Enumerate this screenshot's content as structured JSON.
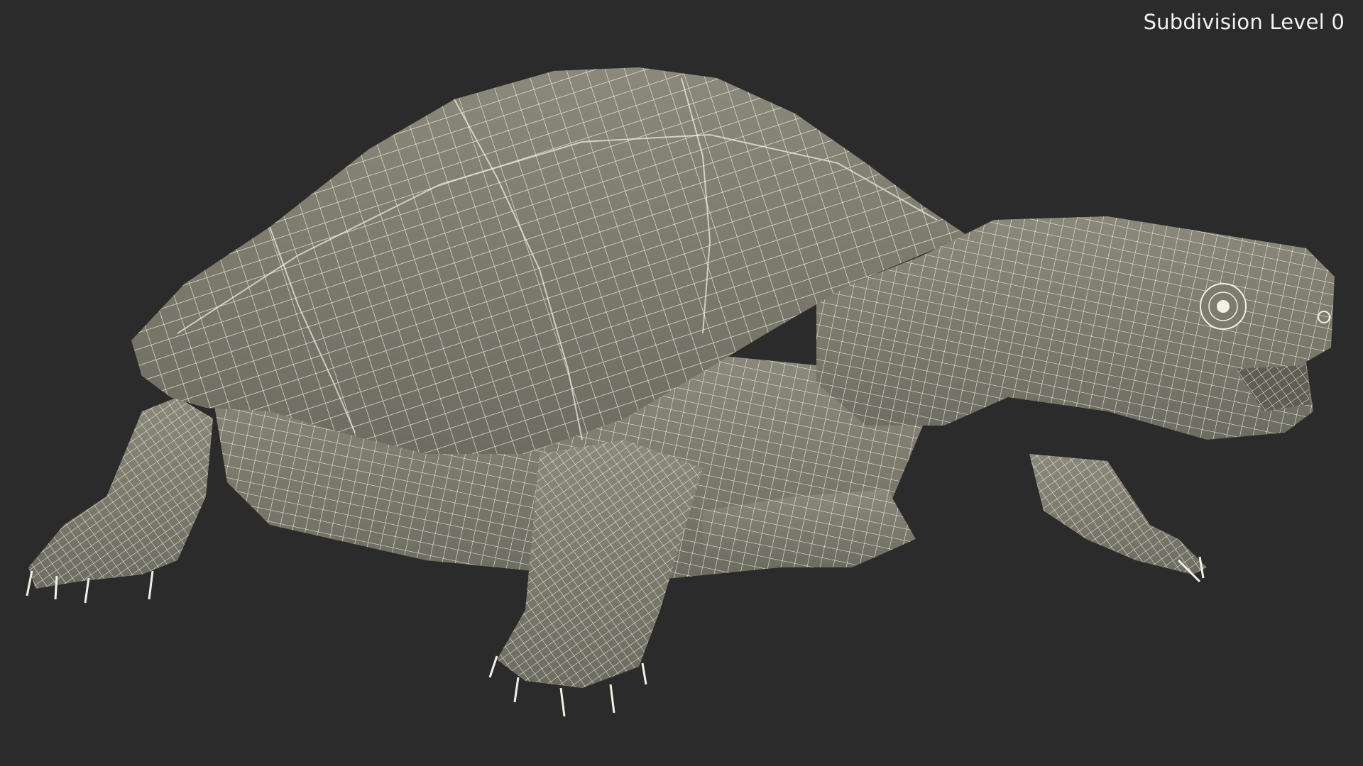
{
  "viewport": {
    "overlay_label": "Subdivision Level 0",
    "background_color": "#2b2b2b",
    "model_color": "#7c7b6d",
    "wire_color": "#f3f1e6",
    "subject": "turtle-wireframe-model"
  }
}
